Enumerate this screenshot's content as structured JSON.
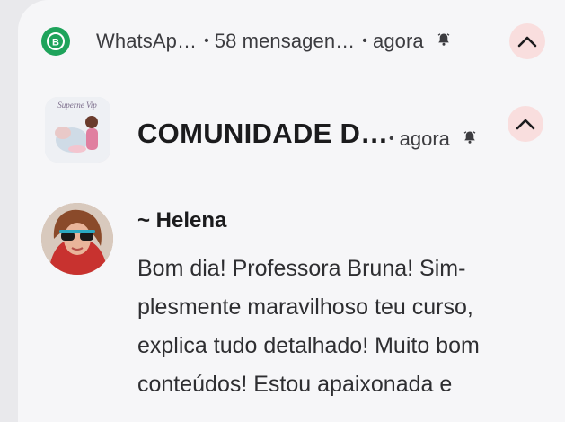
{
  "app": {
    "name": "WhatsAp…",
    "message_count": "58 mensagen…",
    "time": "agora"
  },
  "conversation": {
    "title": "COMUNIDADE D…",
    "time": "agora",
    "thumb_caption": "Superne Vip"
  },
  "message": {
    "sender": "~ Helena",
    "text": "Bom dia! Professora Bruna! Sim-\nplesmente maravilhoso teu curso,\nexplica tudo detalhado! Muito bom\nconteúdos! Estou apaixonada e"
  },
  "icons": {
    "app": "whatsapp-business-icon",
    "bell": "bell-icon",
    "chevron": "chevron-up-icon"
  },
  "colors": {
    "whatsapp_green": "#1ea35b",
    "chevron_bg": "#f9dede"
  }
}
